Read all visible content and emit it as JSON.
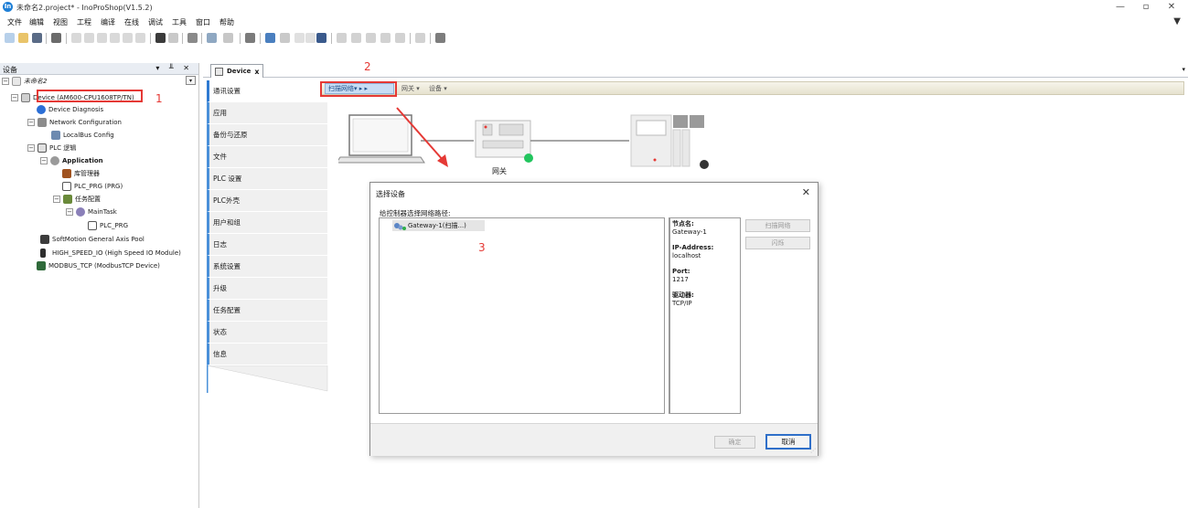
{
  "window": {
    "title": "未命名2.project* - InoProShop(V1.5.2)",
    "app_icon_text": "In"
  },
  "menu": {
    "items": [
      "文件",
      "编辑",
      "视图",
      "工程",
      "编译",
      "在线",
      "调试",
      "工具",
      "窗口",
      "帮助"
    ]
  },
  "left_panel": {
    "title": "设备",
    "controls": "▾ ╨ ✕",
    "root": "未命名2",
    "tree": [
      {
        "label": "Device (AM600-CPU1608TP/TN)",
        "icon": "device-icon"
      },
      {
        "label": "Device Diagnosis",
        "icon": "diagnosis-icon"
      },
      {
        "label": "Network Configuration",
        "icon": "network-config-icon"
      },
      {
        "label": "LocalBus Config",
        "icon": "localbus-icon"
      },
      {
        "label": "PLC 逻辑",
        "icon": "plc-logic-icon"
      },
      {
        "label": "Application",
        "icon": "application-icon"
      },
      {
        "label": "库管理器",
        "icon": "library-manager-icon"
      },
      {
        "label": "PLC_PRG (PRG)",
        "icon": "program-icon"
      },
      {
        "label": "任务配置",
        "icon": "task-config-icon"
      },
      {
        "label": "MainTask",
        "icon": "maintask-icon"
      },
      {
        "label": "PLC_PRG",
        "icon": "program-call-icon"
      },
      {
        "label": "SoftMotion General Axis Pool",
        "icon": "axis-pool-icon"
      },
      {
        "label": "HIGH_SPEED_IO (High Speed IO Module)",
        "icon": "io-module-icon"
      },
      {
        "label": "MODBUS_TCP (ModbusTCP Device)",
        "icon": "modbus-icon"
      }
    ]
  },
  "annotations": {
    "one": "1",
    "two": "2",
    "three": "3"
  },
  "editor": {
    "tab_label": "Device",
    "tab_close": "x",
    "dropdown": "▾"
  },
  "settings_nav": [
    "通讯设置",
    "应用",
    "备份与还原",
    "文件",
    "PLC 设置",
    "PLC外壳",
    "用户和组",
    "日志",
    "系统设置",
    "升级",
    "任务配置",
    "状态",
    "信息"
  ],
  "content_bar": {
    "scan_network": "扫描网络▾ ▸ ▸",
    "gateway": "网关 ▾",
    "device": "设备 ▾"
  },
  "diagram": {
    "gateway_label": "网关",
    "gateway_status_color": "#22c55e",
    "device_status_color": "#333333"
  },
  "dialog": {
    "title": "选择设备",
    "close": "✕",
    "prompt": "给控制器选择网络路径:",
    "gateway_item": "Gateway-1(扫描...)",
    "info": {
      "node_name_key": "节点名:",
      "node_name_val": "Gateway-1",
      "ip_key": "IP-Address:",
      "ip_val": "localhost",
      "port_key": "Port:",
      "port_val": "1217",
      "driver_key": "驱动器:",
      "driver_val": "TCP/IP"
    },
    "scan_button": "扫描网络",
    "wink_button": "闪烁",
    "ok_button": "确定",
    "cancel_button": "取消"
  }
}
